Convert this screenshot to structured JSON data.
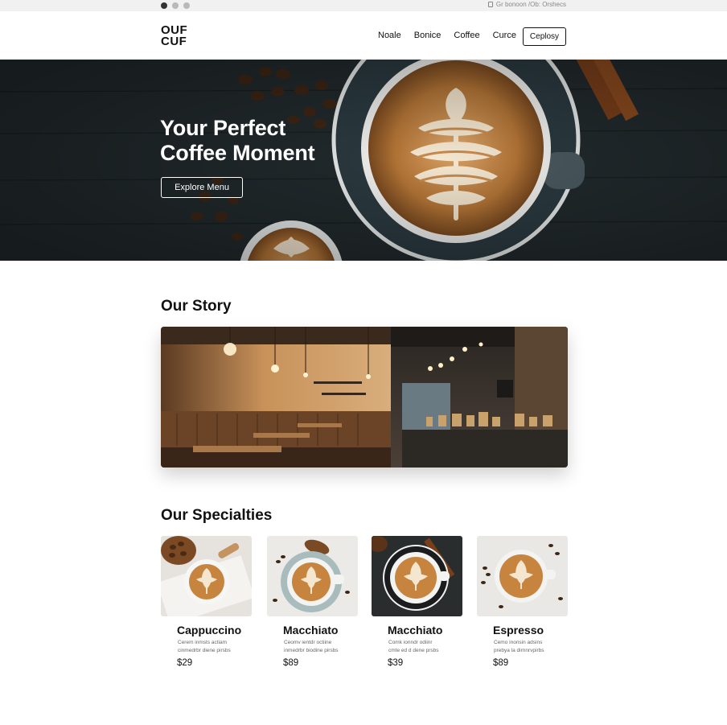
{
  "chrome": {
    "url_text": "Gr bonoon /Ob: Orshecs"
  },
  "header": {
    "logo_line1": "OUF",
    "logo_line2": "CUF",
    "nav": [
      "Noale",
      "Bonice",
      "Coffee",
      "Curce"
    ],
    "cta_label": "Ceplosy"
  },
  "hero": {
    "title_line1": "Your Perfect",
    "title_line2": "Coffee Moment",
    "button_label": "Explore Menu"
  },
  "story": {
    "title": "Our Story"
  },
  "specialties": {
    "title": "Our Specialties",
    "items": [
      {
        "name": "Cappuccino",
        "desc_line1": "Cerem inmsts actiam",
        "desc_line2": "cinmedrbr diene pirsbs",
        "price": "$29"
      },
      {
        "name": "Macchiato",
        "desc_line1": "Ceomv ientdr octiine",
        "desc_line2": "inmedrbr biodine pirsbs",
        "price": "$89"
      },
      {
        "name": "Macchiato",
        "desc_line1": "Comk ionndr odiinr",
        "desc_line2": "cmte ed d dene prsbs",
        "price": "$39"
      },
      {
        "name": "Espresso",
        "desc_line1": "Cemo inonsin adsins",
        "desc_line2": "prebya la dirnnrvpirbs",
        "price": "$89"
      }
    ]
  },
  "colors": {
    "hero_bg": "#1f2629",
    "latte": "#b97a3c",
    "foam": "#f4e6cf",
    "cup_rim": "#e9ecec"
  }
}
